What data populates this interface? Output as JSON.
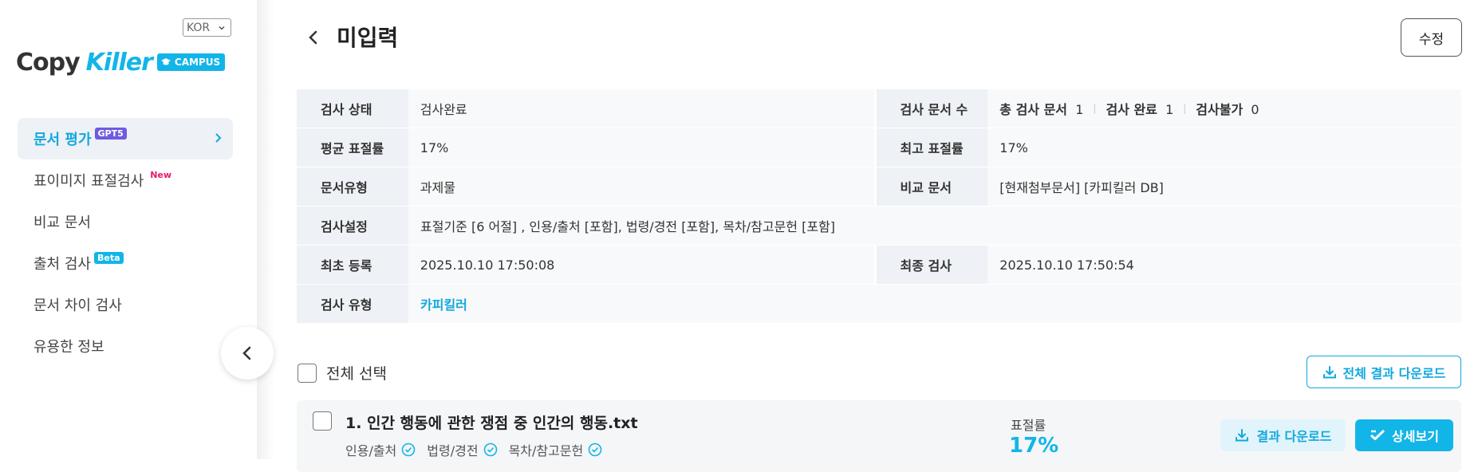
{
  "sidebar": {
    "language": "KOR",
    "logo": {
      "copy": "Copy",
      "killer": "Killer",
      "campus": "CAMPUS"
    },
    "items": [
      {
        "label": "문서 평가",
        "badge": "GPT5"
      },
      {
        "label": "표이미지 표절검사",
        "badge": "New"
      },
      {
        "label": "비교 문서",
        "badge": ""
      },
      {
        "label": "출처 검사",
        "badge": "Beta"
      },
      {
        "label": "문서 차이 검사",
        "badge": ""
      },
      {
        "label": "유용한 정보",
        "badge": ""
      }
    ]
  },
  "header": {
    "title": "미입력",
    "edit_label": "수정"
  },
  "info": {
    "status_label": "검사 상태",
    "status_value": "검사완료",
    "count_label": "검사 문서 수",
    "total_label": "총 검사 문서",
    "total_value": "1",
    "done_label": "검사 완료",
    "done_value": "1",
    "fail_label": "검사불가",
    "fail_value": "0",
    "avg_label": "평균 표절률",
    "avg_value": "17%",
    "max_label": "최고 표절률",
    "max_value": "17%",
    "type_label": "문서유형",
    "type_value": "과제물",
    "compare_label": "비교 문서",
    "compare_value": "[현재첨부문서] [카피킬러 DB]",
    "setting_label": "검사설정",
    "setting_value": "표절기준 [6 어절] , 인용/출처 [포함], 법령/경전 [포함], 목차/참고문헌 [포함]",
    "first_label": "최초 등록",
    "first_value": "2025.10.10 17:50:08",
    "last_label": "최종 검사",
    "last_value": "2025.10.10 17:50:54",
    "checktype_label": "검사 유형",
    "checktype_value": "카피킬러"
  },
  "list": {
    "select_all": "전체 선택",
    "download_all": "전체 결과 다운로드",
    "docs": [
      {
        "title": "1. 인간 행동에 관한 쟁점 중 인간의 행동.txt",
        "tags": [
          "인용/출처",
          "법령/경전",
          "목차/참고문헌"
        ],
        "rate_label": "표절률",
        "rate_value": "17%",
        "download_label": "결과 다운로드",
        "detail_label": "상세보기"
      }
    ]
  },
  "colors": {
    "accent": "#12b5e8",
    "gpt_badge": "#6f5ae0",
    "new_badge": "#e8196d"
  }
}
